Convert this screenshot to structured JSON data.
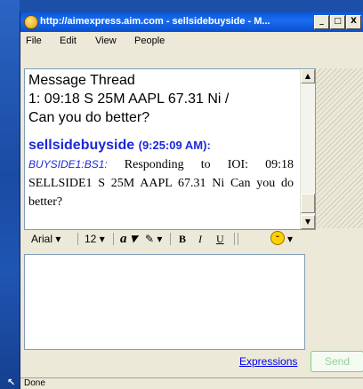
{
  "window": {
    "title": "http://aimexpress.aim.com - sellsidebuyside - M...",
    "controls": {
      "minimize": "_",
      "maximize": "□",
      "close": "X"
    }
  },
  "menu": [
    "File",
    "Edit",
    "View",
    "People"
  ],
  "thread": {
    "header_lines": [
      "Message Thread",
      "1: 09:18 S 25M AAPL 67.31 Ni /",
      "Can you do better?"
    ],
    "sender": "sellsidebuyside",
    "sender_time": "(9:25:09 AM):",
    "message_user": "BUYSIDE1:BS1:",
    "message_text": "Responding to IOI: 09:18 SELLSIDE1 S 25M AAPL 67.31 Ni Can you do better?"
  },
  "format_toolbar": {
    "font": "Arial",
    "size": "12",
    "text_color_icon": "a",
    "highlight_icon": "pencil",
    "bold": "B",
    "italic": "I",
    "underline": "U",
    "emoticon": "smiley-icon"
  },
  "actions": {
    "expressions_label": "Expressions",
    "send_label": "Send"
  },
  "status": {
    "text": "Done"
  },
  "colors": {
    "titlebar": "#0a57d8",
    "sender": "#1c28d8",
    "link": "#0000ee",
    "send_border": "#7bd07b"
  }
}
